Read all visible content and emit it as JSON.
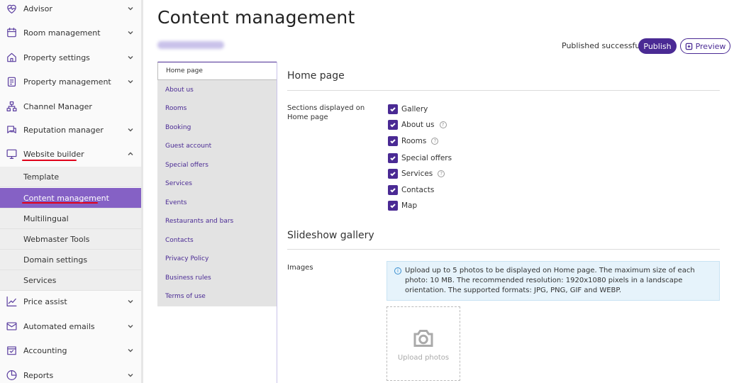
{
  "sidebar": {
    "items": [
      {
        "label": "Advisor",
        "icon": "heart-pulse-icon",
        "chevron": "down"
      },
      {
        "label": "Room management",
        "icon": "calendar-icon",
        "chevron": "down"
      },
      {
        "label": "Property settings",
        "icon": "home-icon",
        "chevron": "down"
      },
      {
        "label": "Property management",
        "icon": "clipboard-icon",
        "chevron": "down"
      },
      {
        "label": "Channel Manager",
        "icon": "sitemap-icon",
        "chevron": ""
      },
      {
        "label": "Reputation manager",
        "icon": "chat-icon",
        "chevron": "down"
      },
      {
        "label": "Website builder",
        "icon": "monitor-icon",
        "chevron": "up"
      },
      {
        "label": "Price assist",
        "icon": "trend-icon",
        "chevron": "down"
      },
      {
        "label": "Automated emails",
        "icon": "mail-icon",
        "chevron": "down"
      },
      {
        "label": "Accounting",
        "icon": "wallet-check-icon",
        "chevron": "down"
      },
      {
        "label": "Reports",
        "icon": "pie-chart-icon",
        "chevron": "down"
      }
    ],
    "subitems": [
      {
        "label": "Template"
      },
      {
        "label": "Content management",
        "active": true
      },
      {
        "label": "Multilingual"
      },
      {
        "label": "Webmaster Tools"
      },
      {
        "label": "Domain settings"
      },
      {
        "label": "Services"
      }
    ]
  },
  "header": {
    "title": "Content management",
    "status": "Published successfully",
    "publish_label": "Publish",
    "preview_label": "Preview"
  },
  "content_menu": [
    {
      "label": "Home page",
      "active": true
    },
    {
      "label": "About us"
    },
    {
      "label": "Rooms"
    },
    {
      "label": "Booking"
    },
    {
      "label": "Guest account"
    },
    {
      "label": "Special offers"
    },
    {
      "label": "Services"
    },
    {
      "label": "Events"
    },
    {
      "label": "Restaurants and bars"
    },
    {
      "label": "Contacts"
    },
    {
      "label": "Privacy Policy"
    },
    {
      "label": "Business rules"
    },
    {
      "label": "Terms of use"
    }
  ],
  "home_page": {
    "title": "Home page",
    "sections_label": "Sections displayed on Home page",
    "sections": [
      {
        "label": "Gallery",
        "checked": true,
        "help": false
      },
      {
        "label": "About us",
        "checked": true,
        "help": true
      },
      {
        "label": "Rooms",
        "checked": true,
        "help": true
      },
      {
        "label": "Special offers",
        "checked": true,
        "help": false
      },
      {
        "label": "Services",
        "checked": true,
        "help": true
      },
      {
        "label": "Contacts",
        "checked": true,
        "help": false
      },
      {
        "label": "Map",
        "checked": true,
        "help": false
      }
    ]
  },
  "slideshow": {
    "title": "Slideshow gallery",
    "images_label": "Images",
    "info_text": "Upload up to 5 photos to be displayed on Home page. The maximum size of each photo: 10 MB. The recommended resolution: 1920x1080 pixels in a landscape orientation. The supported formats: JPG, PNG, GIF and WEBP.",
    "upload_label": "Upload photos"
  },
  "colors": {
    "accent": "#4a2a94",
    "sidebar_active": "#8561c5",
    "underline": "#e0001a"
  }
}
